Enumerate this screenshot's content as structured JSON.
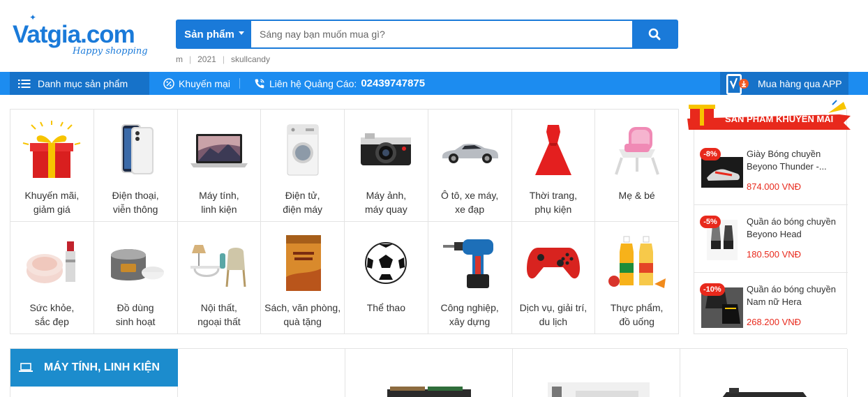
{
  "logo": {
    "text": "Vatgia.com",
    "tagline": "Happy shopping"
  },
  "search": {
    "category_label": "Sản phẩm",
    "placeholder": "Sáng nay bạn muốn mua gì?",
    "button_icon": "search-icon"
  },
  "keywords": [
    "m",
    "2021",
    "skullcandy"
  ],
  "nav": {
    "category_menu": "Danh mục sản phẩm",
    "promo": "Khuyến mại",
    "contact_label": "Liên hệ Quảng Cáo:",
    "contact_phone": "02439747875",
    "app": "Mua hàng qua APP"
  },
  "categories": [
    {
      "label": "Khuyến mãi,\ngiảm giá",
      "icon": "gift-icon"
    },
    {
      "label": "Điện thoại,\nviễn thông",
      "icon": "phone-icon"
    },
    {
      "label": "Máy tính,\nlinh kiện",
      "icon": "laptop-icon"
    },
    {
      "label": "Điện tử,\nđiện máy",
      "icon": "washing-machine-icon"
    },
    {
      "label": "Máy ảnh,\nmáy quay",
      "icon": "camera-icon"
    },
    {
      "label": "Ô tô, xe máy,\nxe đạp",
      "icon": "car-icon"
    },
    {
      "label": "Thời trang,\nphụ kiện",
      "icon": "dress-icon"
    },
    {
      "label": "Mẹ & bé",
      "icon": "baby-chair-icon"
    },
    {
      "label": "Sức khỏe,\nsắc đẹp",
      "icon": "cosmetics-icon"
    },
    {
      "label": "Đồ dùng\nsinh hoạt",
      "icon": "rice-cooker-icon"
    },
    {
      "label": "Nội thất,\nngoại thất",
      "icon": "furniture-icon"
    },
    {
      "label": "Sách, văn phòng,\nquà tặng",
      "icon": "book-icon"
    },
    {
      "label": "Thể thao",
      "icon": "football-icon"
    },
    {
      "label": "Công nghiệp,\nxây dựng",
      "icon": "drill-icon"
    },
    {
      "label": "Dịch vụ, giải trí,\ndu lịch",
      "icon": "gamepad-icon"
    },
    {
      "label": "Thực phẩm,\nđồ uống",
      "icon": "juice-icon"
    }
  ],
  "promo": {
    "title": "SẢN PHẨM KHUYẾN MÃI",
    "items": [
      {
        "badge": "-8%",
        "name": "Giày Bóng chuyền Beyono Thunder -...",
        "price": "874.000 VNĐ"
      },
      {
        "badge": "-5%",
        "name": "Quần áo bóng chuyền Beyono Head",
        "price": "180.500 VNĐ"
      },
      {
        "badge": "-10%",
        "name": "Quần áo bóng chuyền Nam nữ Hera",
        "price": "268.200 VNĐ"
      }
    ]
  },
  "section": {
    "title": "MÁY TÍNH, LINH KIỆN"
  },
  "colors": {
    "brand": "#1a7ad9",
    "nav": "#1c8cf0",
    "sale": "#e8291c"
  }
}
